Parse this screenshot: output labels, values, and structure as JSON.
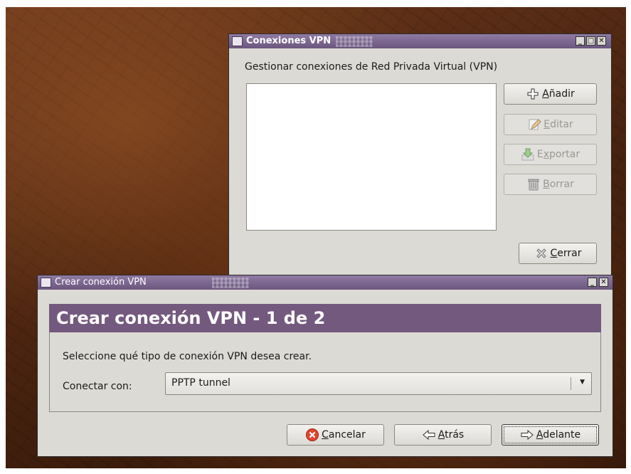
{
  "vpn_window": {
    "title": "Conexiones VPN",
    "description": "Gestionar conexiones de Red Privada Virtual (VPN)",
    "buttons": {
      "add": {
        "mnemonic": "A",
        "rest": "ñadir"
      },
      "edit": {
        "mnemonic": "E",
        "rest": "ditar"
      },
      "export": {
        "pre": "E",
        "mnemonic": "x",
        "rest": "portar"
      },
      "delete": {
        "mnemonic": "B",
        "rest": "orrar"
      },
      "close": {
        "mnemonic": "C",
        "rest": "errar"
      }
    }
  },
  "create_window": {
    "title": "Crear conexión VPN",
    "header": "Crear conexión VPN - 1 de 2",
    "prompt": "Seleccione qué tipo de conexión VPN desea crear.",
    "connect_label": "Conectar con:",
    "connection_type": "PPTP tunnel",
    "buttons": {
      "cancel": {
        "mnemonic": "C",
        "rest": "ancelar"
      },
      "back": {
        "mnemonic": "A",
        "rest": "trás"
      },
      "forward": {
        "mnemonic": "A",
        "rest": "delante"
      }
    }
  },
  "colors": {
    "titlebar": "#6b567e",
    "header_panel": "#74597e",
    "window_bg": "#dcdad5"
  },
  "icons": [
    "window-menu-icon",
    "minimize-icon",
    "maximize-icon",
    "close-icon",
    "add-icon",
    "edit-icon",
    "export-icon",
    "trash-icon",
    "close-x-icon",
    "cancel-icon",
    "back-arrow-icon",
    "forward-arrow-icon",
    "dropdown-arrow-icon"
  ]
}
